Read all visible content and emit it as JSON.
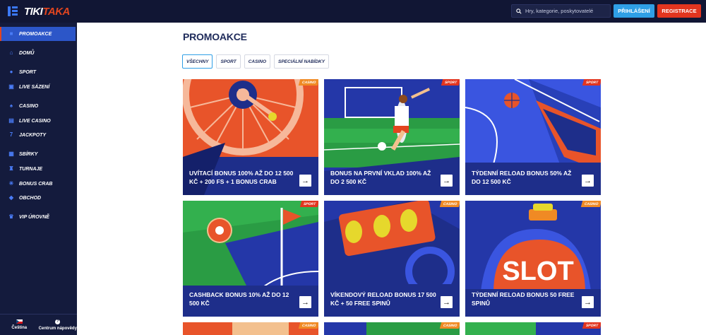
{
  "header": {
    "logo_a": "TIKI",
    "logo_b": "TAKA",
    "search_placeholder": "Hry, kategorie, poskytovatelé",
    "login_label": "PŘIHLÁŠENÍ",
    "register_label": "REGISTRACE"
  },
  "sidebar": {
    "items": [
      {
        "label": "PROMOAKCE",
        "icon": "gift-icon"
      },
      {
        "label": "DOMŮ",
        "icon": "home-icon"
      },
      {
        "label": "SPORT",
        "icon": "ball-icon"
      },
      {
        "label": "LIVE SÁZENÍ",
        "icon": "live-icon"
      },
      {
        "label": "CASINO",
        "icon": "cards-icon"
      },
      {
        "label": "LIVE CASINO",
        "icon": "dealer-icon"
      },
      {
        "label": "JACKPOTY",
        "icon": "seven-icon"
      },
      {
        "label": "SBÍRKY",
        "icon": "collection-icon"
      },
      {
        "label": "TURNAJE",
        "icon": "trophy-icon"
      },
      {
        "label": "BONUS CRAB",
        "icon": "crab-icon"
      },
      {
        "label": "OBCHOD",
        "icon": "shop-icon"
      },
      {
        "label": "VIP ÚROVNĚ",
        "icon": "crown-icon"
      }
    ],
    "language": "Čeština",
    "help": "Centrum nápovědy"
  },
  "main": {
    "title": "PROMOAKCE",
    "filters": [
      "VŠECHNY",
      "SPORT",
      "CASINO",
      "SPECIÁLNÍ NABÍDKY"
    ],
    "cards": [
      {
        "badge": "CASINO",
        "title": "UVÍTACÍ BONUS 100% AŽ DO 12 500 KČ + 200 FS + 1 BONUS CRAB"
      },
      {
        "badge": "SPORT",
        "title": "BONUS NA PRVNÍ VKLAD 100% AŽ DO 2 500 KČ"
      },
      {
        "badge": "SPORT",
        "title": "TÝDENNÍ RELOAD BONUS 50% AŽ DO 12 500 KČ"
      },
      {
        "badge": "SPORT",
        "title": "CASHBACK BONUS 10% AŽ DO 12 500 KČ"
      },
      {
        "badge": "CASINO",
        "title": "VÍKENDOVÝ RELOAD BONUS 17 500 KČ + 50 FREE SPINŮ"
      },
      {
        "badge": "CASINO",
        "title": "TÝDENNÍ RELOAD BONUS 50 FREE SPINŮ"
      },
      {
        "badge": "CASINO",
        "title": ""
      },
      {
        "badge": "CASINO",
        "title": ""
      },
      {
        "badge": "SPORT",
        "title": ""
      }
    ],
    "card3_art_text": "SLOT",
    "arrow": "→"
  }
}
